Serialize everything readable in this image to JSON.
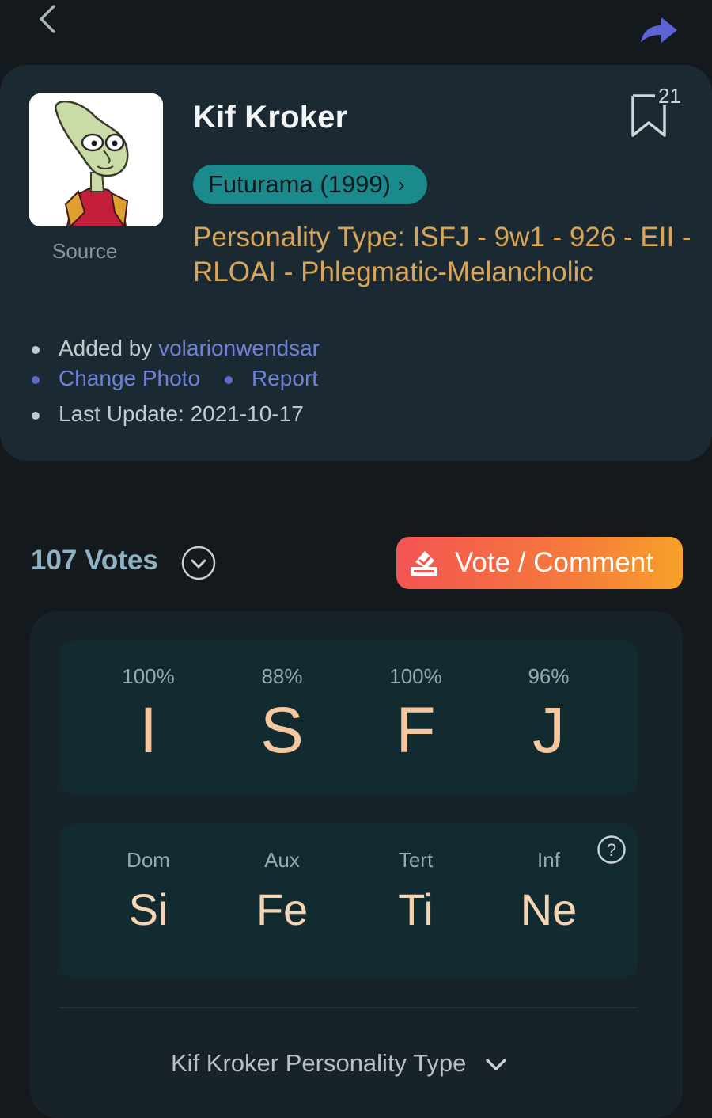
{
  "character": {
    "name": "Kif Kroker",
    "series": "Futurama (1999)",
    "personality_type": "Personality Type: ISFJ - 9w1 - 926 - EII - RLOAI - Phlegmatic-Melancholic",
    "photo_source_label": "Source",
    "bookmark_count": "21"
  },
  "meta": {
    "added_by_prefix": "Added by ",
    "added_by_user": "volarionwendsar",
    "change_photo": "Change Photo",
    "report": "Report",
    "last_update": "Last Update: 2021-10-17"
  },
  "votes": {
    "label": "107 Votes",
    "vote_button": "Vote / Comment"
  },
  "mbti": [
    {
      "percent": "100%",
      "letter": "I"
    },
    {
      "percent": "88%",
      "letter": "S"
    },
    {
      "percent": "100%",
      "letter": "F"
    },
    {
      "percent": "96%",
      "letter": "J"
    }
  ],
  "functions": [
    {
      "label": "Dom",
      "value": "Si"
    },
    {
      "label": "Aux",
      "value": "Fe"
    },
    {
      "label": "Tert",
      "value": "Ti"
    },
    {
      "label": "Inf",
      "value": "Ne"
    }
  ],
  "footer": {
    "toggle_label": "Kif Kroker Personality Type"
  },
  "colors": {
    "background": "#13191d",
    "card": "#1b2932",
    "accent_teal": "#1a8a8d",
    "type_text": "#d9a659",
    "link": "#6f82d8",
    "vote_gradient_start": "#f35453",
    "vote_gradient_end": "#f6a12a",
    "share_arrow": "#5b63d6"
  },
  "icons": {
    "back": "chevron-left-icon",
    "share": "share-arrow-icon",
    "bookmark": "bookmark-icon",
    "votes_toggle": "chevron-down-circle-icon",
    "vote": "ballot-box-icon",
    "help": "question-circle-icon",
    "footer_toggle": "chevron-down-icon"
  }
}
